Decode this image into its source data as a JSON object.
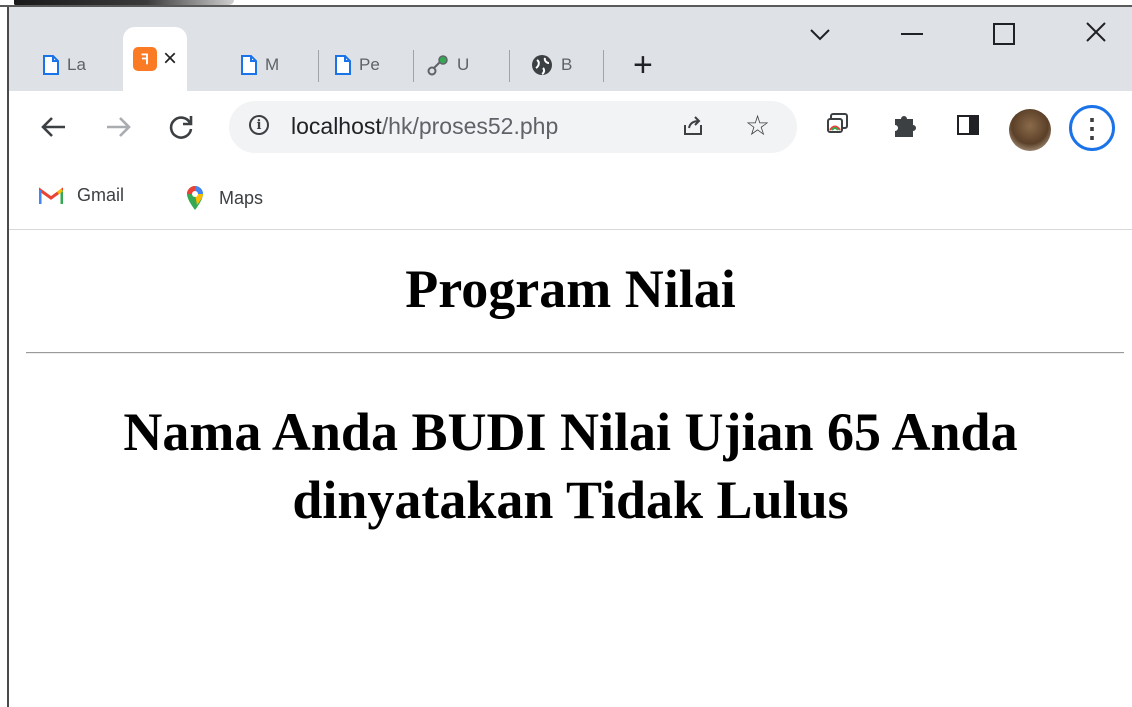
{
  "tabs": [
    {
      "label": "La",
      "icon": "document-icon"
    },
    {
      "label": "",
      "icon": "xampp-icon",
      "active": true
    },
    {
      "label": "M",
      "icon": "document-icon"
    },
    {
      "label": "Pe",
      "icon": "document-icon"
    },
    {
      "label": "U",
      "icon": "link-icon"
    },
    {
      "label": "B",
      "icon": "globe-icon"
    }
  ],
  "toolbar": {
    "url_host": "localhost",
    "url_path": "/hk/proses52.php"
  },
  "bookmarks": [
    {
      "label": "Gmail",
      "icon": "gmail-icon"
    },
    {
      "label": "Maps",
      "icon": "maps-icon"
    }
  ],
  "page": {
    "title": "Program Nilai",
    "result": "Nama Anda BUDI Nilai Ujian 65 Anda dinyatakan Tidak Lulus"
  },
  "colors": {
    "tabstrip": "#dee1e6",
    "accent": "#1a73e8",
    "xampp": "#fb7a24"
  }
}
